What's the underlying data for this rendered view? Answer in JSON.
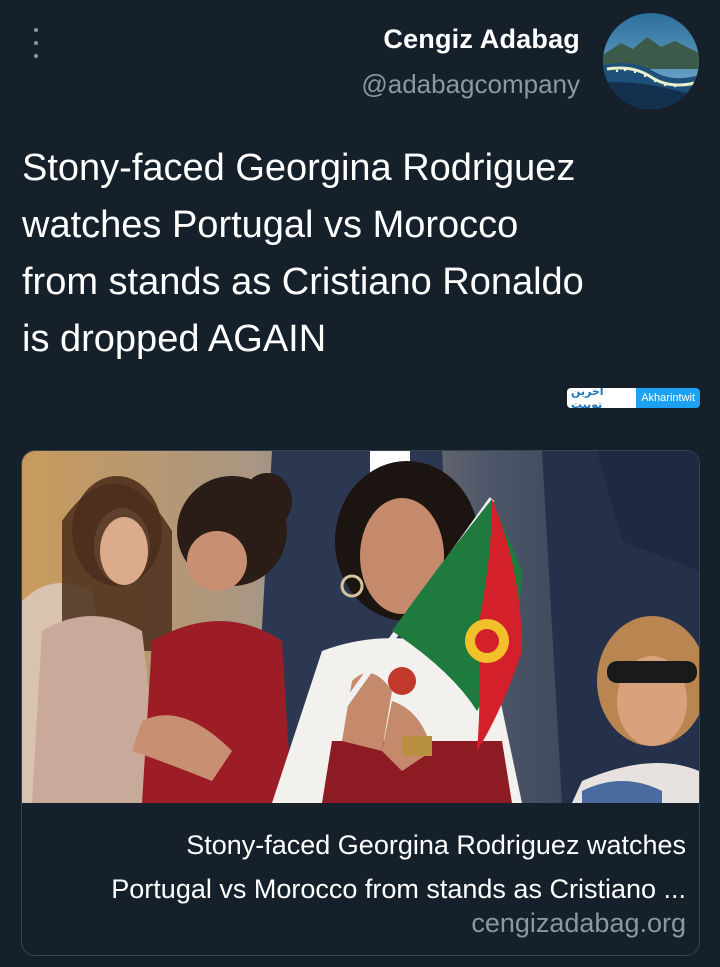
{
  "tweet": {
    "author_name": "Cengiz Adabag",
    "author_handle": "@adabagcompany",
    "text_lines": [
      "Stony-faced Georgina Rodriguez",
      "watches Portugal vs Morocco",
      "from stands as Cristiano Ronaldo",
      "is dropped AGAIN"
    ],
    "watermark": {
      "arabic": "آخرین توییت",
      "latin": "Akharintwit"
    }
  },
  "link_card": {
    "title_lines": [
      "Stony-faced Georgina Rodriguez watches",
      "Portugal vs Morocco from stands as Cristiano ..."
    ],
    "domain": "cengizadabag.org"
  },
  "icons": {
    "more_menu": "more-vertical-icon"
  },
  "colors": {
    "background": "#15202b",
    "secondary_text": "#8899a6",
    "border": "#38444d",
    "flag_green": "#1f7a3e",
    "flag_red": "#d3202b"
  }
}
